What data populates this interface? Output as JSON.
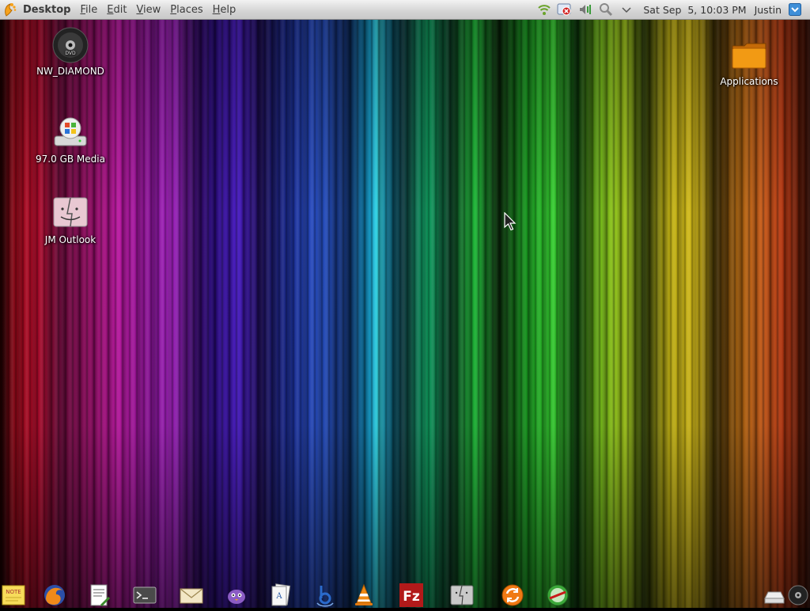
{
  "top_panel": {
    "app_menu": "Desktop",
    "menus": [
      {
        "label": "File"
      },
      {
        "label": "Edit"
      },
      {
        "label": "View"
      },
      {
        "label": "Places"
      },
      {
        "label": "Help"
      }
    ],
    "tray_icons": [
      "network-icon",
      "close-notification-icon",
      "volume-icon",
      "search-icon",
      "chevron-down-icon"
    ],
    "clock": "Sat Sep  5, 10:03 PM",
    "user": "Justin"
  },
  "desktop_icons": [
    {
      "label": "NW_DIAMOND",
      "icon": "dvd-disc-icon"
    },
    {
      "label": "97.0 GB Media",
      "icon": "hard-drive-windows-icon"
    },
    {
      "label": "JM Outlook",
      "icon": "finder-drive-icon"
    },
    {
      "label": "Applications",
      "icon": "folder-icon"
    }
  ],
  "dock": {
    "left_icons": [
      "sticky-notes-icon",
      "firefox-icon",
      "text-editor-icon",
      "terminal-icon",
      "mail-icon",
      "pidgin-icon",
      "office-document-icon",
      "banshee-icon",
      "vlc-icon",
      "filezilla-icon",
      "finder-icon",
      "update-icon",
      "disk-utility-icon"
    ],
    "right_icons": [
      "removable-drive-icon",
      "dvd-icon"
    ]
  },
  "colors": {
    "panel_bg": "#d4d4d4",
    "label_text": "#ffffff"
  }
}
